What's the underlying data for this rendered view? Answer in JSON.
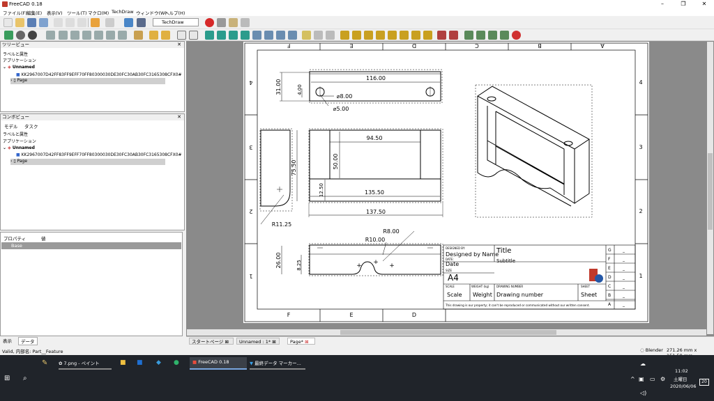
{
  "window": {
    "title": "FreeCAD 0.18",
    "minimize": "–",
    "maximize": "❐",
    "close": "✕"
  },
  "menu": [
    "ファイル(F)",
    "編集(E)",
    "表示(V)",
    "ツール(T)",
    "マクロ(M)",
    "TechDraw",
    "ウィンドウ(W)",
    "ヘルプ(H)"
  ],
  "workbench": "TechDraw",
  "treeview": {
    "title": "ツリービュー",
    "header_labels": "ラベルと属性",
    "application": "アプリケーション",
    "doc": "Unnamed",
    "item1": "KK2967007D42FF83FF9EFF70FF80300030DE30FC30AB30FC3165308CFX0#",
    "item2": "Page"
  },
  "combo": {
    "title": "コンボビュー",
    "tab_model": "モデル",
    "tab_task": "タスク",
    "header_labels": "ラベルと属性",
    "application": "アプリケーション",
    "doc": "Unnamed",
    "item1": "KK2967007D42FF83FF9EFF70FF80300030DE30FC30AB30FC3165308CFX0#",
    "item2": "Page"
  },
  "props": {
    "col_prop": "プロパティ",
    "col_val": "値",
    "group": "Base",
    "tab_view": "表示",
    "tab_data": "データ"
  },
  "tabs": {
    "start": "スタートページ",
    "unnamed": "Unnamed : 1*",
    "page": "Page*"
  },
  "status": {
    "left": "Valid, 内部名: Part__Feature",
    "nav": "Blender",
    "dims": "271.26 mm x 151.59 mm"
  },
  "taskbar": {
    "app1": "7.png - ペイント",
    "app2": "FreeCAD 0.18",
    "app3": "最終データ マーカー...",
    "time": "11:02",
    "day": "土曜日",
    "date": "2020/06/06",
    "notif": "20"
  },
  "drawing": {
    "cols": [
      "F",
      "E",
      "D",
      "C",
      "B",
      "A"
    ],
    "rows": [
      "4",
      "3",
      "2",
      "1"
    ],
    "dims": {
      "d116": "116.00",
      "d31": "31.00",
      "d4": "4.00",
      "phi8": "⌀8.00",
      "phi5": "⌀5.00",
      "d9450": "94.50",
      "d50": "50.00",
      "d7550": "75.50",
      "d1250": "12.50",
      "d13550": "135.50",
      "d13750": "137.50",
      "r1125": "R11.25",
      "r8": "R8.00",
      "r10": "R10.00",
      "d26": "26.00",
      "d825": "8.25"
    },
    "title_block": {
      "designed_by_label": "DESIGNED BY:",
      "designed_by": "Designed by Name",
      "date_label": "DATE:",
      "date": "Date",
      "title": "Title",
      "subtitle": "Subtitle",
      "size_label": "SIZE",
      "size": "A4",
      "scale_label": "SCALE",
      "scale": "Scale",
      "weight_label": "WEIGHT (kg)",
      "weight": "Weight",
      "drawing_number_label": "DRAWING NUMBER",
      "drawing_number": "Drawing number",
      "sheet_label": "SHEET",
      "sheet": "Sheet",
      "note": "This drawing is our property; it can't be reproduced or communicated without our written consent.",
      "rev_letters": [
        "G",
        "F",
        "E",
        "D",
        "C",
        "B",
        "A"
      ],
      "rev_dash": "_"
    }
  }
}
